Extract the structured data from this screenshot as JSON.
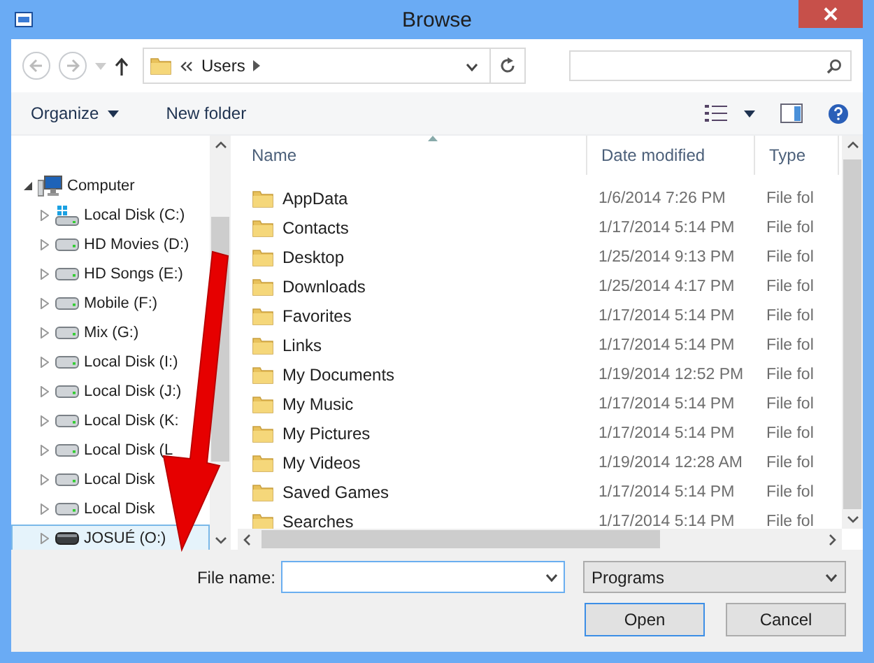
{
  "window": {
    "title": "Browse"
  },
  "address": {
    "crumbs": [
      "Users"
    ]
  },
  "toolbar": {
    "organize": "Organize",
    "new_folder": "New folder"
  },
  "navigation": {
    "items": [
      {
        "label": "Computer",
        "kind": "computer",
        "expanded": true,
        "selected": false,
        "children": [
          {
            "label": "Local Disk (C:)",
            "kind": "system",
            "expanded": false,
            "selected": false
          },
          {
            "label": "HD Movies (D:)",
            "kind": "disk",
            "expanded": false,
            "selected": false
          },
          {
            "label": "HD Songs (E:)",
            "kind": "disk",
            "expanded": false,
            "selected": false
          },
          {
            "label": "Mobile (F:)",
            "kind": "disk",
            "expanded": false,
            "selected": false
          },
          {
            "label": "Mix (G:)",
            "kind": "disk",
            "expanded": false,
            "selected": false
          },
          {
            "label": "Local Disk (I:)",
            "kind": "disk",
            "expanded": false,
            "selected": false
          },
          {
            "label": "Local Disk (J:)",
            "kind": "disk",
            "expanded": false,
            "selected": false
          },
          {
            "label": "Local Disk (K:",
            "kind": "disk",
            "expanded": false,
            "selected": false
          },
          {
            "label": "Local Disk (L",
            "kind": "disk",
            "expanded": false,
            "selected": false
          },
          {
            "label": "Local Disk",
            "kind": "disk",
            "expanded": false,
            "selected": false
          },
          {
            "label": "Local Disk",
            "kind": "disk",
            "expanded": false,
            "selected": false
          },
          {
            "label": "JOSUÉ (O:)",
            "kind": "removable",
            "expanded": false,
            "selected": true
          }
        ]
      }
    ]
  },
  "table": {
    "columns": [
      "Name",
      "Date modified",
      "Type"
    ],
    "rows": [
      {
        "name": "AppData",
        "date": "1/6/2014 7:26 PM",
        "type": "File fol"
      },
      {
        "name": "Contacts",
        "date": "1/17/2014 5:14 PM",
        "type": "File fol"
      },
      {
        "name": "Desktop",
        "date": "1/25/2014 9:13 PM",
        "type": "File fol"
      },
      {
        "name": "Downloads",
        "date": "1/25/2014 4:17 PM",
        "type": "File fol"
      },
      {
        "name": "Favorites",
        "date": "1/17/2014 5:14 PM",
        "type": "File fol"
      },
      {
        "name": "Links",
        "date": "1/17/2014 5:14 PM",
        "type": "File fol"
      },
      {
        "name": "My Documents",
        "date": "1/19/2014 12:52 PM",
        "type": "File fol"
      },
      {
        "name": "My Music",
        "date": "1/17/2014 5:14 PM",
        "type": "File fol"
      },
      {
        "name": "My Pictures",
        "date": "1/17/2014 5:14 PM",
        "type": "File fol"
      },
      {
        "name": "My Videos",
        "date": "1/19/2014 12:28 AM",
        "type": "File fol"
      },
      {
        "name": "Saved Games",
        "date": "1/17/2014 5:14 PM",
        "type": "File fol"
      },
      {
        "name": "Searches",
        "date": "1/17/2014 5:14 PM",
        "type": "File fol"
      }
    ]
  },
  "footer": {
    "file_name_label": "File name:",
    "filter": "Programs",
    "buttons": [
      "Open",
      "Cancel"
    ]
  }
}
